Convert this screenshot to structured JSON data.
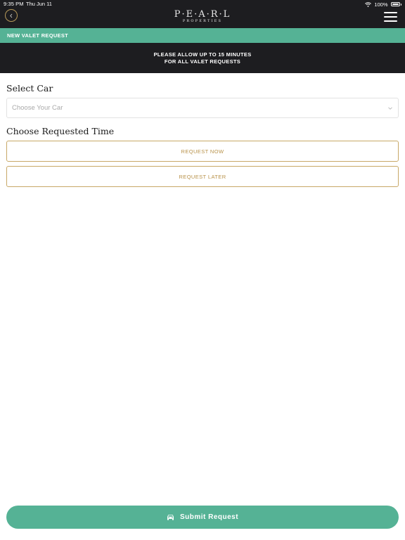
{
  "status_bar": {
    "time": "9:35 PM",
    "date": "Thu Jun 11",
    "battery": "100%"
  },
  "header": {
    "logo_main": "P·E·A·R·L",
    "logo_sub": "PROPERTIES",
    "back_icon": "chevron-left-icon",
    "menu_icon": "hamburger-menu-icon"
  },
  "section": {
    "title": "NEW VALET REQUEST"
  },
  "notice": {
    "line1": "PLEASE ALLOW UP TO 15 MINUTES",
    "line2": "FOR ALL VALET REQUESTS"
  },
  "form": {
    "select_car_label": "Select Car",
    "car_placeholder": "Choose Your Car",
    "time_label": "Choose Requested Time",
    "request_now": "REQUEST NOW",
    "request_later": "REQUEST LATER"
  },
  "submit": {
    "label": "Submit Request",
    "icon": "car-icon"
  },
  "colors": {
    "header_bg": "#1d1d20",
    "accent_green": "#55b295",
    "gold": "#c8a867",
    "gold_text": "#b8924a"
  }
}
